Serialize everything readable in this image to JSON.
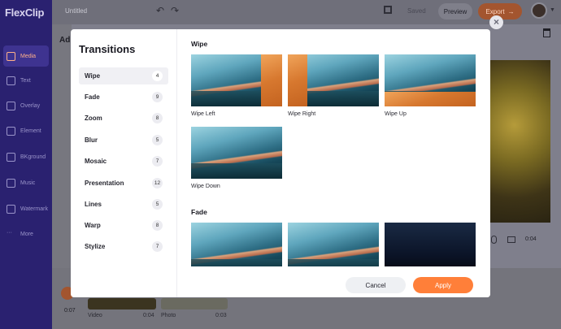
{
  "app": {
    "logo": "FlexClip",
    "doc_title": "Untitled",
    "saved_label": "Saved",
    "preview_label": "Preview",
    "export_label": "Export",
    "panel_heading": "Ad",
    "total_time": "0:04",
    "accent_color": "#ff7f39"
  },
  "sidebar": {
    "items": [
      {
        "label": "Media",
        "icon": "media-icon"
      },
      {
        "label": "Text",
        "icon": "text-icon"
      },
      {
        "label": "Overlay",
        "icon": "overlay-icon"
      },
      {
        "label": "Element",
        "icon": "element-icon"
      },
      {
        "label": "BKground",
        "icon": "background-icon"
      },
      {
        "label": "Music",
        "icon": "music-icon"
      },
      {
        "label": "Watermark",
        "icon": "watermark-icon"
      },
      {
        "label": "More",
        "icon": "more-icon"
      }
    ]
  },
  "timeline": {
    "current_time": "0:07",
    "clips": [
      {
        "label": "Video",
        "duration": "0:04"
      },
      {
        "label": "Photo",
        "duration": "0:03"
      }
    ]
  },
  "modal": {
    "title": "Transitions",
    "categories": [
      {
        "label": "Wipe",
        "count": "4"
      },
      {
        "label": "Fade",
        "count": "9"
      },
      {
        "label": "Zoom",
        "count": "8"
      },
      {
        "label": "Blur",
        "count": "5"
      },
      {
        "label": "Mosaic",
        "count": "7"
      },
      {
        "label": "Presentation",
        "count": "12"
      },
      {
        "label": "Lines",
        "count": "5"
      },
      {
        "label": "Warp",
        "count": "8"
      },
      {
        "label": "Stylize",
        "count": "7"
      }
    ],
    "sections": {
      "wipe_title": "Wipe",
      "fade_title": "Fade",
      "wipe_items": [
        "Wipe Left",
        "Wipe Right",
        "Wipe Up",
        "Wipe Down"
      ]
    },
    "cancel_label": "Cancel",
    "apply_label": "Apply"
  }
}
